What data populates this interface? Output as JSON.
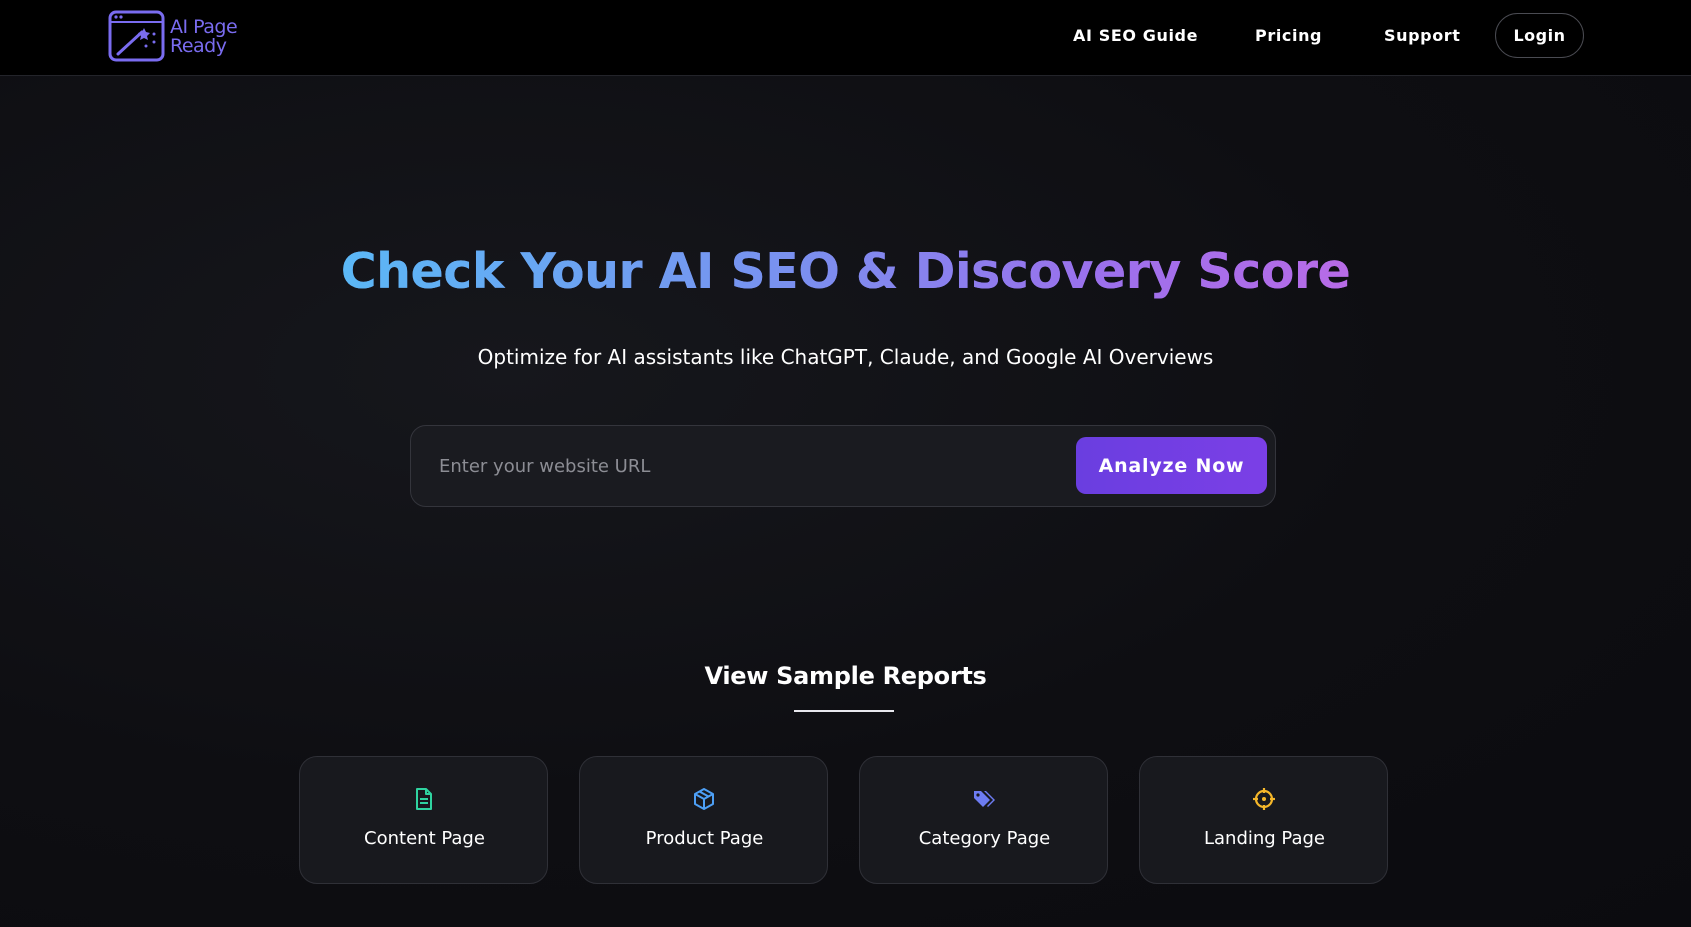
{
  "brand": {
    "name_line1": "AI Page",
    "name_line2": "Ready",
    "logo_icon": "browser-wand-icon",
    "color": "#7a6cf0"
  },
  "nav": {
    "items": [
      {
        "label": "AI SEO Guide"
      },
      {
        "label": "Pricing"
      },
      {
        "label": "Support"
      }
    ],
    "login_label": "Login"
  },
  "hero": {
    "title": "Check Your AI SEO & Discovery Score",
    "subtitle": "Optimize for AI assistants like ChatGPT, Claude, and Google AI Overviews",
    "input_value": "",
    "input_placeholder": "Enter your website URL",
    "cta_label": "Analyze Now",
    "cta_color": "#7b3fe6",
    "title_gradient": [
      "#5bb8f6",
      "#b86be7"
    ]
  },
  "samples": {
    "title": "View Sample Reports",
    "cards": [
      {
        "label": "Content Page",
        "icon": "document-icon",
        "icon_color": "#2fd3a0"
      },
      {
        "label": "Product Page",
        "icon": "cube-icon",
        "icon_color": "#4d9ff5"
      },
      {
        "label": "Category Page",
        "icon": "tags-icon",
        "icon_color": "#6d7cf2"
      },
      {
        "label": "Landing Page",
        "icon": "crosshair-icon",
        "icon_color": "#f5b72a"
      }
    ]
  }
}
